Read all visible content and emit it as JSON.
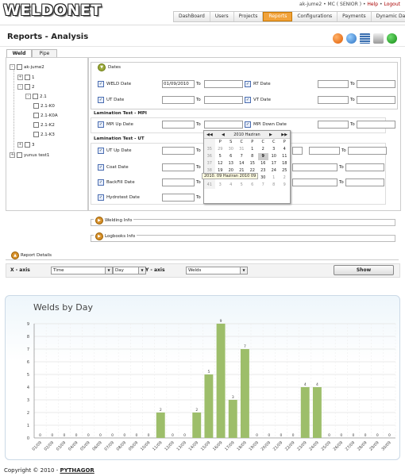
{
  "app": {
    "logo": "WELDONET"
  },
  "user_bar": {
    "user": "ak-jume2",
    "role": "MC ( SENIOR )",
    "help": "Help",
    "logout": "Logout"
  },
  "nav": [
    "DashBoard",
    "Users",
    "Projects",
    "Reports",
    "Configurations",
    "Payments",
    "Dynamic Data"
  ],
  "nav_active": "Reports",
  "page": {
    "title": "Reports - Analysis"
  },
  "toolbar_icons": [
    "info-icon",
    "refresh-icon",
    "list-icon",
    "print-icon",
    "help-icon"
  ],
  "tabs": [
    "Weld",
    "Pipe"
  ],
  "tree": [
    {
      "label": "ak-jume2",
      "level": 0,
      "expander": "-"
    },
    {
      "label": "1",
      "level": 1,
      "expander": "+"
    },
    {
      "label": "2",
      "level": 1,
      "expander": "-"
    },
    {
      "label": "2.1",
      "level": 2,
      "expander": "-"
    },
    {
      "label": "2.1-K0",
      "level": 3,
      "expander": ""
    },
    {
      "label": "2.1-K0A",
      "level": 3,
      "expander": ""
    },
    {
      "label": "2.1-K2",
      "level": 3,
      "expander": ""
    },
    {
      "label": "2.1-K3",
      "level": 3,
      "expander": ""
    },
    {
      "label": "3",
      "level": 1,
      "expander": "+"
    },
    {
      "label": "yunus test1",
      "level": 0,
      "expander": "+"
    }
  ],
  "dates": {
    "section": "Dates",
    "to_label": "To",
    "weld_date": {
      "label": "WELD Date",
      "from": "01/09/2010",
      "to": ""
    },
    "rt_date": {
      "label": "RT Date"
    },
    "ut_date": {
      "label": "UT Date"
    },
    "vt_date": {
      "label": "VT Date"
    },
    "lamination_mpi": "Lamination Test - MPI",
    "mpi_up": {
      "label": "MPI Up Date"
    },
    "mpi_down": {
      "label": "MPI Down Date"
    },
    "lamination_ut": "Lamination Test - UT",
    "ut_up": {
      "label": "UT Up Date"
    },
    "coat": {
      "label": "Coat Date"
    },
    "backfill": {
      "label": "BackFill Date"
    },
    "hydro": {
      "label": "Hydrotest Date"
    }
  },
  "calendar": {
    "header": "2010  Haziran",
    "days": [
      "P",
      "S",
      "C",
      "P",
      "C",
      "C",
      "P"
    ],
    "weeks": [
      [
        "35",
        "29",
        "30",
        "31",
        "1",
        "2",
        "3",
        "4"
      ],
      [
        "36",
        "5",
        "6",
        "7",
        "8",
        "9",
        "10",
        "11"
      ],
      [
        "37",
        "12",
        "13",
        "14",
        "15",
        "16",
        "17",
        "18"
      ],
      [
        "38",
        "19",
        "20",
        "21",
        "22",
        "23",
        "24",
        "25"
      ],
      [
        "40",
        "26",
        "27",
        "28",
        "29",
        "30",
        "1",
        "2"
      ],
      [
        "41",
        "3",
        "4",
        "5",
        "6",
        "7",
        "8",
        "9"
      ]
    ],
    "tooltip": "2010. 09 Haziran 2010 09"
  },
  "welding_info": "Welding Info",
  "logbooks_info": "Logbooks Info",
  "report_details": "Report Details",
  "filters": {
    "x_axis_label": "X - axis",
    "x_value": "Time",
    "x_unit": "Day",
    "y_axis_label": "Y - axis",
    "y_value": "Welds",
    "show": "Show"
  },
  "chart_data": {
    "type": "bar",
    "title": "Welds by Day",
    "categories": [
      "01/09",
      "02/09",
      "03/09",
      "04/09",
      "05/09",
      "06/09",
      "07/09",
      "08/09",
      "09/09",
      "10/09",
      "11/09",
      "12/09",
      "13/09",
      "14/09",
      "15/09",
      "16/09",
      "17/09",
      "18/09",
      "19/09",
      "20/09",
      "21/09",
      "22/09",
      "23/09",
      "24/09",
      "25/09",
      "26/09",
      "27/09",
      "28/09",
      "29/09",
      "30/09"
    ],
    "values": [
      0,
      0,
      0,
      0,
      0,
      0,
      0,
      0,
      0,
      0,
      2,
      0,
      0,
      2,
      5,
      9,
      3,
      7,
      0,
      0,
      0,
      0,
      4,
      4,
      0,
      0,
      0,
      0,
      0,
      0
    ],
    "ylim": [
      0,
      9
    ],
    "yticks": [
      0,
      1,
      2,
      3,
      4,
      5,
      6,
      7,
      8,
      9
    ],
    "bar_color": "#9dbe6a",
    "grid": "horizontal"
  },
  "footer": {
    "copyright": "Copyright © 2010 - ",
    "brand": "PYTHAGOR"
  }
}
